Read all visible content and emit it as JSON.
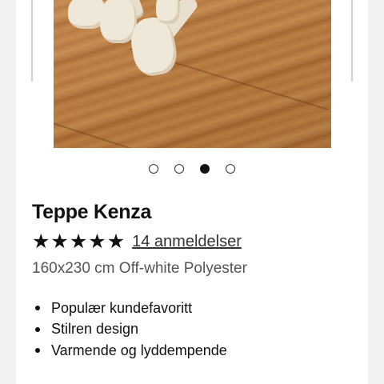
{
  "gallery": {
    "image_alt": "Teppe Kenza på tregulv",
    "slide_count": 4,
    "active_index": 2
  },
  "product": {
    "title": "Teppe Kenza",
    "rating": 5,
    "max_rating": 5,
    "star_glyph": "★",
    "reviews_label": "14 anmeldelser",
    "specs": "160x230 cm Off-white Polyester",
    "features": [
      "Populær kundefavoritt",
      "Stilren design",
      "Varmende og lyddempende"
    ]
  },
  "colors": {
    "text": "#111111",
    "muted": "#555555",
    "card": "#ffffff",
    "background": "#f2f2f2"
  }
}
